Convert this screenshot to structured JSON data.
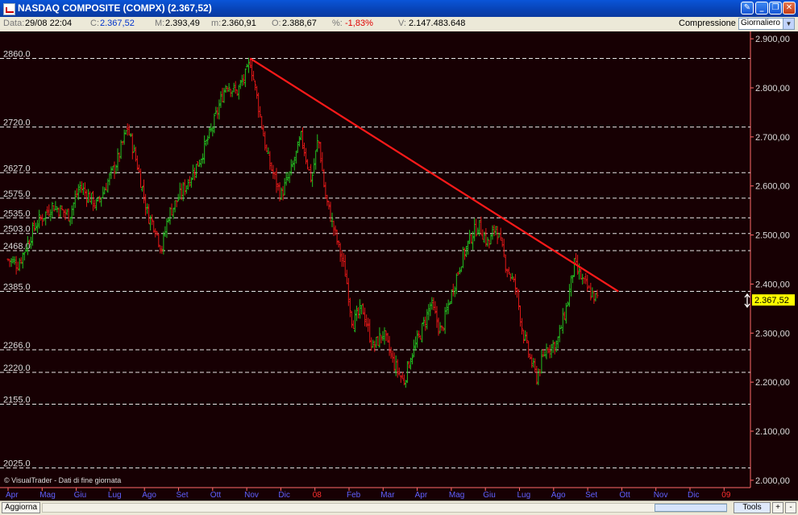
{
  "window": {
    "title": "NASDAQ COMPOSITE (COMPX) (2.367,52)",
    "buttons": [
      "pin-icon",
      "minimize-icon",
      "restore-icon",
      "close-icon"
    ]
  },
  "info": {
    "data_label": "Data:",
    "data_value": "29/08 22:04",
    "c_label": "C:",
    "c_value": "2.367,52",
    "m_max_label": "M:",
    "m_max_value": "2.393,49",
    "m_min_label": "m:",
    "m_min_value": "2.360,91",
    "o_label": "O:",
    "o_value": "2.388,67",
    "pct_label": "%:",
    "pct_value": "-1,83%",
    "v_label": "V:",
    "v_value": "2.147.483.648",
    "compression_label": "Compressione",
    "compression_value": "Giornaliero"
  },
  "status": {
    "refresh_label": "Aggiorna",
    "tools_label": "Tools",
    "plus": "+",
    "minus": "-"
  },
  "colors": {
    "background": "#170003",
    "up": "#22c022",
    "down": "#e01818",
    "trendline": "#ff1a1a",
    "level_line": "#e6e6e6",
    "axis_text": "#dddddd",
    "month_text": "#6060ff",
    "last_price_bg": "#ffff00"
  },
  "chart_data": {
    "type": "candlestick",
    "title": "NASDAQ COMPOSITE (COMPX)",
    "y_axis_ticks": [
      "2.000,00",
      "2.100,00",
      "2.200,00",
      "2.300,00",
      "2.400,00",
      "2.500,00",
      "2.600,00",
      "2.700,00",
      "2.800,00",
      "2.900,00"
    ],
    "ylim": [
      1985,
      2915
    ],
    "x_months": [
      "Apr",
      "Mag",
      "Giu",
      "Lug",
      "Ago",
      "Set",
      "Ott",
      "Nov",
      "Dic",
      "08",
      "Feb",
      "Mar",
      "Apr",
      "Mag",
      "Giu",
      "Lug",
      "Ago",
      "Set",
      "Ott",
      "Nov",
      "Dic",
      "09"
    ],
    "highlighted_months": [
      "08",
      "09"
    ],
    "levels": [
      {
        "label": "2860.0",
        "value": 2860.0
      },
      {
        "label": "2720.0",
        "value": 2720.0
      },
      {
        "label": "2627.0",
        "value": 2627.0
      },
      {
        "label": "2575.0",
        "value": 2575.0
      },
      {
        "label": "2535.0",
        "value": 2535.0
      },
      {
        "label": "2503.0",
        "value": 2503.0
      },
      {
        "label": "2468.0",
        "value": 2468.0
      },
      {
        "label": "2385.0",
        "value": 2385.0
      },
      {
        "label": "2266.0",
        "value": 2266.0
      },
      {
        "label": "2220.0",
        "value": 2220.0
      },
      {
        "label": "2155.0",
        "value": 2155.0
      },
      {
        "label": "2025.0",
        "value": 2025.0
      }
    ],
    "close_anchors": [
      {
        "m": 0.0,
        "v": 2450
      },
      {
        "m": 0.3,
        "v": 2440
      },
      {
        "m": 0.8,
        "v": 2520
      },
      {
        "m": 1.3,
        "v": 2560
      },
      {
        "m": 1.8,
        "v": 2540
      },
      {
        "m": 2.1,
        "v": 2600
      },
      {
        "m": 2.6,
        "v": 2560
      },
      {
        "m": 3.2,
        "v": 2650
      },
      {
        "m": 3.5,
        "v": 2720
      },
      {
        "m": 3.8,
        "v": 2640
      },
      {
        "m": 4.1,
        "v": 2540
      },
      {
        "m": 4.3,
        "v": 2520
      },
      {
        "m": 4.5,
        "v": 2470
      },
      {
        "m": 4.7,
        "v": 2540
      },
      {
        "m": 5.2,
        "v": 2600
      },
      {
        "m": 5.6,
        "v": 2650
      },
      {
        "m": 6.0,
        "v": 2720
      },
      {
        "m": 6.4,
        "v": 2810
      },
      {
        "m": 6.7,
        "v": 2790
      },
      {
        "m": 7.0,
        "v": 2830
      },
      {
        "m": 7.1,
        "v": 2855
      },
      {
        "m": 7.3,
        "v": 2780
      },
      {
        "m": 7.6,
        "v": 2660
      },
      {
        "m": 8.0,
        "v": 2580
      },
      {
        "m": 8.3,
        "v": 2630
      },
      {
        "m": 8.6,
        "v": 2700
      },
      {
        "m": 8.9,
        "v": 2610
      },
      {
        "m": 9.1,
        "v": 2700
      },
      {
        "m": 9.3,
        "v": 2580
      },
      {
        "m": 9.6,
        "v": 2500
      },
      {
        "m": 9.9,
        "v": 2420
      },
      {
        "m": 10.1,
        "v": 2320
      },
      {
        "m": 10.4,
        "v": 2350
      },
      {
        "m": 10.7,
        "v": 2270
      },
      {
        "m": 11.0,
        "v": 2300
      },
      {
        "m": 11.3,
        "v": 2240
      },
      {
        "m": 11.6,
        "v": 2200
      },
      {
        "m": 11.8,
        "v": 2250
      },
      {
        "m": 12.1,
        "v": 2300
      },
      {
        "m": 12.4,
        "v": 2360
      },
      {
        "m": 12.7,
        "v": 2300
      },
      {
        "m": 13.0,
        "v": 2380
      },
      {
        "m": 13.3,
        "v": 2450
      },
      {
        "m": 13.6,
        "v": 2500
      },
      {
        "m": 13.8,
        "v": 2520
      },
      {
        "m": 14.1,
        "v": 2480
      },
      {
        "m": 14.3,
        "v": 2520
      },
      {
        "m": 14.6,
        "v": 2440
      },
      {
        "m": 14.9,
        "v": 2390
      },
      {
        "m": 15.1,
        "v": 2300
      },
      {
        "m": 15.3,
        "v": 2250
      },
      {
        "m": 15.5,
        "v": 2210
      },
      {
        "m": 15.8,
        "v": 2270
      },
      {
        "m": 16.1,
        "v": 2280
      },
      {
        "m": 16.4,
        "v": 2360
      },
      {
        "m": 16.6,
        "v": 2440
      },
      {
        "m": 16.9,
        "v": 2400
      },
      {
        "m": 17.1,
        "v": 2380
      },
      {
        "m": 17.3,
        "v": 2368
      }
    ],
    "trendline": {
      "start_month": 7.1,
      "start_value": 2860,
      "end_month": 17.9,
      "end_value": 2385
    },
    "last_price": "2.367,52",
    "credit": "© VisualTrader - Dati di fine giornata"
  }
}
